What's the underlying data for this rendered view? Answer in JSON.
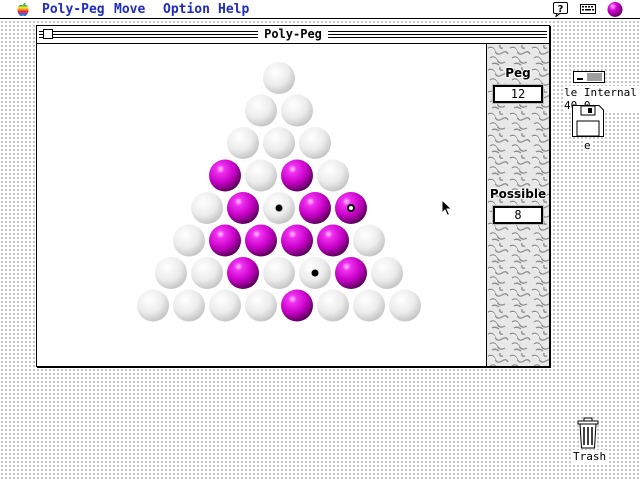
{
  "menubar": {
    "items": [
      "Poly-Peg",
      "Move",
      "Option",
      "Help"
    ]
  },
  "window": {
    "title": "Poly-Peg"
  },
  "panel": {
    "peg_label": "Peg",
    "peg_value": "12",
    "possible_label": "Possible",
    "possible_value": "8"
  },
  "desktop": {
    "hard_disk_label": "le Internal 40-0",
    "floppy_label": "e",
    "trash_label": "Trash"
  },
  "colors": {
    "peg": "#d400d4",
    "empty_hole": "#e4e4e4",
    "menu_text": "#1f2bbf"
  },
  "board": {
    "rows": [
      [
        0
      ],
      [
        0,
        0
      ],
      [
        0,
        0,
        0
      ],
      [
        1,
        0,
        1,
        0
      ],
      [
        0,
        1,
        0,
        1,
        1
      ],
      [
        0,
        1,
        1,
        1,
        1,
        0
      ],
      [
        0,
        0,
        1,
        0,
        0,
        1,
        0
      ],
      [
        0,
        0,
        0,
        0,
        1,
        0,
        0,
        0
      ]
    ],
    "markers": [
      {
        "row": 4,
        "col": 2,
        "kind": "dot"
      },
      {
        "row": 4,
        "col": 4,
        "kind": "ring"
      },
      {
        "row": 6,
        "col": 4,
        "kind": "dot"
      }
    ]
  }
}
